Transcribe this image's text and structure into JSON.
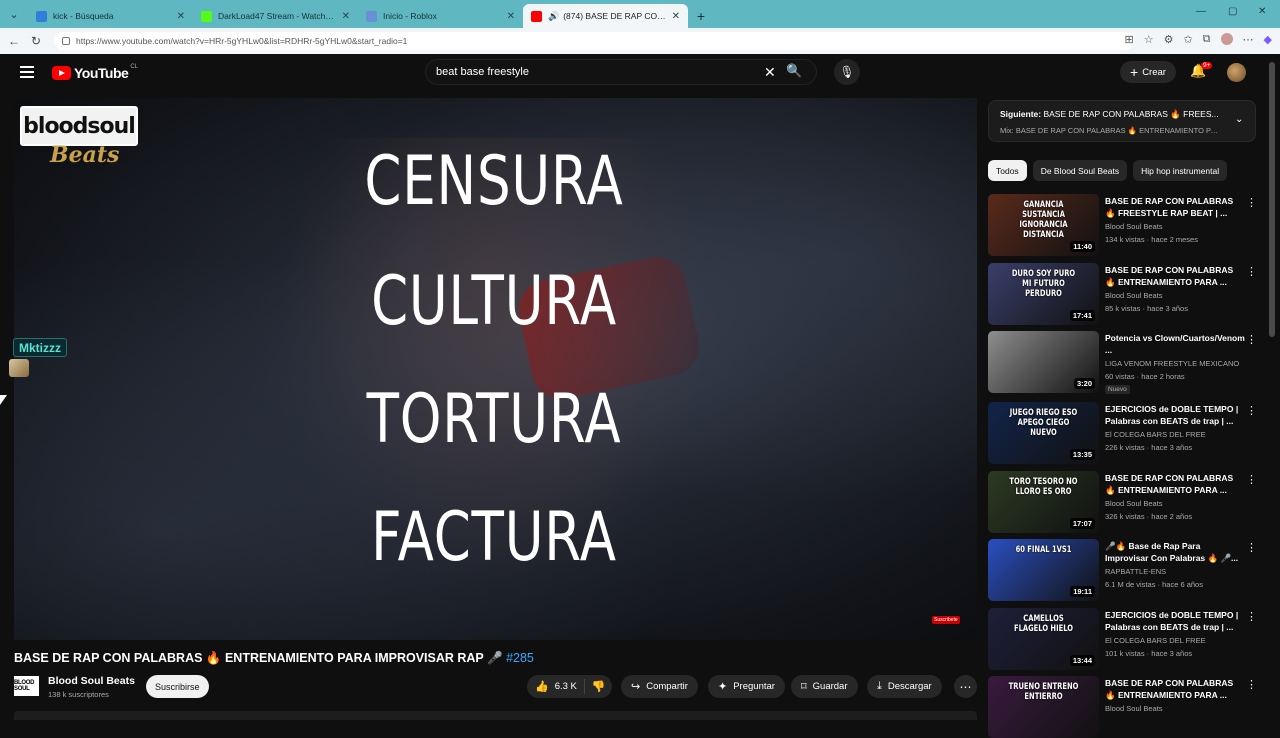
{
  "browser": {
    "tabs": [
      {
        "title": "kick - Búsqueda",
        "favicon_color": "#2f7ed8",
        "active": false
      },
      {
        "title": "DarkLoad47 Stream - Watch Live o",
        "favicon_color": "#53fc18",
        "active": false
      },
      {
        "title": "Inicio - Roblox",
        "favicon_color": "#6b8fd6",
        "active": false
      },
      {
        "title": "(874) BASE DE RAP CON PALA",
        "favicon_color": "#ff0000",
        "active": true
      }
    ],
    "new_tab": "+",
    "url": "https://www.youtube.com/watch?v=HRr-5gYHLw0&list=RDHRr-5gYHLw0&start_radio=1"
  },
  "header": {
    "logo_text": "YouTube",
    "country": "CL",
    "search_value": "beat base freestyle",
    "create_label": "Crear",
    "notifications_badge": "9+"
  },
  "video": {
    "channel_logo_top": "bloodsoul",
    "channel_logo_bottom": "Beats",
    "words": [
      "CENSURA",
      "CULTURA",
      "TORTURA",
      "FACTURA"
    ],
    "subscribe_chip": "Suscribete",
    "overlay_user": "Mktizzz"
  },
  "info": {
    "title": "BASE DE RAP CON PALABRAS 🔥 ENTRENAMIENTO PARA IMPROVISAR RAP 🎤",
    "hashtag": "#285",
    "channel_avatar_text": "BLOOD SOUL",
    "channel": "Blood Soul Beats",
    "subscribers": "138 k suscriptores",
    "subscribe_label": "Suscribirse",
    "likes": "6.3 K",
    "share": "Compartir",
    "ask": "Preguntar",
    "save": "Guardar",
    "download": "Descargar"
  },
  "up_next": {
    "title_prefix": "Siguiente:",
    "title": "BASE DE RAP CON PALABRAS 🔥 FREES...",
    "subtitle": "Mix: BASE DE RAP CON PALABRAS 🔥 ENTRENAMIENTO PA..."
  },
  "chips": [
    "Todos",
    "De Blood Soul Beats",
    "Hip hop instrumental"
  ],
  "recommendations": [
    {
      "thumb_text": "GANANCIA SUSTANCIA IGNORANCIA DISTANCIA",
      "duration": "11:40",
      "title": "BASE DE RAP CON PALABRAS 🔥 FREESTYLE RAP BEAT | ...",
      "channel": "Blood Soul Beats",
      "meta": "134 k vistas · hace 2 meses",
      "badge": "",
      "bg": "#5a2a1c"
    },
    {
      "thumb_text": "DURO SOY PURO MI FUTURO PERDURO",
      "duration": "17:41",
      "title": "BASE DE RAP CON PALABRAS 🔥 ENTRENAMIENTO PARA ...",
      "channel": "Blood Soul Beats",
      "meta": "85 k vistas · hace 3 años",
      "badge": "",
      "bg": "#3a3f6a"
    },
    {
      "thumb_text": "",
      "duration": "3:20",
      "title": "Potencia vs Clown/Cuartos/Venom ...",
      "channel": "LIGA VENOM FREESTYLE MEXICANO",
      "meta": "60 vistas · hace 2 horas",
      "badge": "Nuevo",
      "bg": "#8e8e8e"
    },
    {
      "thumb_text": "JUEGO RIEGO ESO APEGO CIEGO NUEVO",
      "duration": "13:35",
      "title": "EJERCICIOS de DOBLE TEMPO | Palabras con BEATS de trap | ...",
      "channel": "El COLEGA BARS DEL FREE",
      "meta": "226 k vistas · hace 3 años",
      "badge": "",
      "bg": "#12244a"
    },
    {
      "thumb_text": "TORO TESORO NO LLORO ES ORO",
      "duration": "17:07",
      "title": "BASE DE RAP CON PALABRAS 🔥 ENTRENAMIENTO PARA ...",
      "channel": "Blood Soul Beats",
      "meta": "326 k vistas · hace 2 años",
      "badge": "",
      "bg": "#2c3a22"
    },
    {
      "thumb_text": "60 FINAL 1VS1",
      "duration": "19:11",
      "title": "🎤🔥 Base de Rap Para Improvisar Con Palabras 🔥 🎤...",
      "channel": "RAPBATTLE-ENS",
      "meta": "6.1 M de vistas · hace 6 años",
      "badge": "",
      "bg": "#2a4fc0"
    },
    {
      "thumb_text": "CAMELLOS FLAGELO HIELO",
      "duration": "13:44",
      "title": "EJERCICIOS de DOBLE TEMPO | Palabras con BEATS de trap | ...",
      "channel": "El COLEGA BARS DEL FREE",
      "meta": "101 k vistas · hace 3 años",
      "badge": "",
      "bg": "#1e1f3a"
    },
    {
      "thumb_text": "TRUENO ENTRENO ENTIERRO",
      "duration": "",
      "title": "BASE DE RAP CON PALABRAS 🔥 ENTRENAMIENTO PARA ...",
      "channel": "Blood Soul Beats",
      "meta": "",
      "badge": "",
      "bg": "#3a1a3f"
    }
  ]
}
